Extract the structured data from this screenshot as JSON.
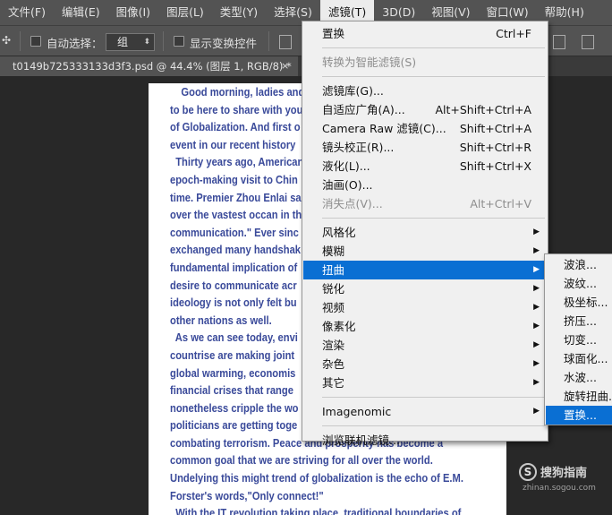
{
  "menubar": {
    "items": [
      {
        "label": "文件(F)"
      },
      {
        "label": "编辑(E)"
      },
      {
        "label": "图像(I)"
      },
      {
        "label": "图层(L)"
      },
      {
        "label": "类型(Y)"
      },
      {
        "label": "选择(S)"
      },
      {
        "label": "滤镜(T)",
        "active": true
      },
      {
        "label": "3D(D)"
      },
      {
        "label": "视图(V)"
      },
      {
        "label": "窗口(W)"
      },
      {
        "label": "帮助(H)"
      }
    ]
  },
  "options_bar": {
    "tool_icon": "move-arrow-icon",
    "auto_select_label": "自动选择：",
    "auto_select_checked": false,
    "auto_select_value": "组",
    "show_transform_label": "显示变换控件",
    "show_transform_checked": false
  },
  "document_tab": {
    "title": "t0149b725333133d3f3.psd @ 44.4% (图层 1, RGB/8) *",
    "close": "×"
  },
  "document_text": {
    "lines": [
      "    Good morning, ladies and",
      "to be here to share with you",
      "of Globalization. And first o",
      "event in our recent history",
      "  Thirty years ago, American",
      "epoch-making visit to Chin",
      "time. Premier Zhou Enlai sa",
      "over the vastest occan in th",
      "communication.\" Ever sinc",
      "exchanged many handshak",
      "fundamental implication of",
      "desire to communicate acr",
      "ideology is not only felt bu",
      "other nations as well.",
      "  As we can see today, envi",
      "countrise are making joint",
      "global warming, economis",
      "financial crises that range",
      "nonetheless cripple the wo",
      "politicians are getting toge",
      "combating terrorism. Peace and prosperity has become a",
      "common goal that we are striving for all over the world.",
      "Undelying this might trend of globalization is the echo of E.M.",
      "Forster's words,\"Only connect!\"",
      "  With the IT revolution taking place, traditional boundaries of"
    ]
  },
  "filter_menu": {
    "items": [
      {
        "type": "item",
        "label": "置换",
        "shortcut": "Ctrl+F"
      },
      {
        "type": "sep"
      },
      {
        "type": "item",
        "label": "转换为智能滤镜(S)",
        "disabled": true
      },
      {
        "type": "sep"
      },
      {
        "type": "item",
        "label": "滤镜库(G)..."
      },
      {
        "type": "item",
        "label": "自适应广角(A)...",
        "shortcut": "Alt+Shift+Ctrl+A"
      },
      {
        "type": "item",
        "label": "Camera Raw 滤镜(C)...",
        "shortcut": "Shift+Ctrl+A"
      },
      {
        "type": "item",
        "label": "镜头校正(R)...",
        "shortcut": "Shift+Ctrl+R"
      },
      {
        "type": "item",
        "label": "液化(L)...",
        "shortcut": "Shift+Ctrl+X"
      },
      {
        "type": "item",
        "label": "油画(O)..."
      },
      {
        "type": "item",
        "label": "消失点(V)...",
        "shortcut": "Alt+Ctrl+V",
        "disabled": true
      },
      {
        "type": "sep"
      },
      {
        "type": "item",
        "label": "风格化",
        "submenu": true
      },
      {
        "type": "item",
        "label": "模糊",
        "submenu": true
      },
      {
        "type": "item",
        "label": "扭曲",
        "submenu": true,
        "highlighted": true
      },
      {
        "type": "item",
        "label": "锐化",
        "submenu": true
      },
      {
        "type": "item",
        "label": "视频",
        "submenu": true
      },
      {
        "type": "item",
        "label": "像素化",
        "submenu": true
      },
      {
        "type": "item",
        "label": "渲染",
        "submenu": true
      },
      {
        "type": "item",
        "label": "杂色",
        "submenu": true
      },
      {
        "type": "item",
        "label": "其它",
        "submenu": true
      },
      {
        "type": "sep"
      },
      {
        "type": "item",
        "label": "Imagenomic",
        "submenu": true
      },
      {
        "type": "sep"
      },
      {
        "type": "item",
        "label": "浏览联机滤镜..."
      }
    ]
  },
  "distort_submenu": {
    "items": [
      {
        "label": "波浪..."
      },
      {
        "label": "波纹..."
      },
      {
        "label": "极坐标..."
      },
      {
        "label": "挤压..."
      },
      {
        "label": "切变..."
      },
      {
        "label": "球面化..."
      },
      {
        "label": "水波..."
      },
      {
        "label": "旋转扭曲..."
      },
      {
        "label": "置换...",
        "highlighted": true
      }
    ]
  },
  "watermark": {
    "logo": "S",
    "brand": "搜狗指南",
    "url": "zhinan.sogou.com"
  },
  "colors": {
    "ui_dark": "#535353",
    "menu_bg": "#f0f0f0",
    "highlight": "#0a6fd3",
    "doc_text": "#3a4a9a"
  }
}
